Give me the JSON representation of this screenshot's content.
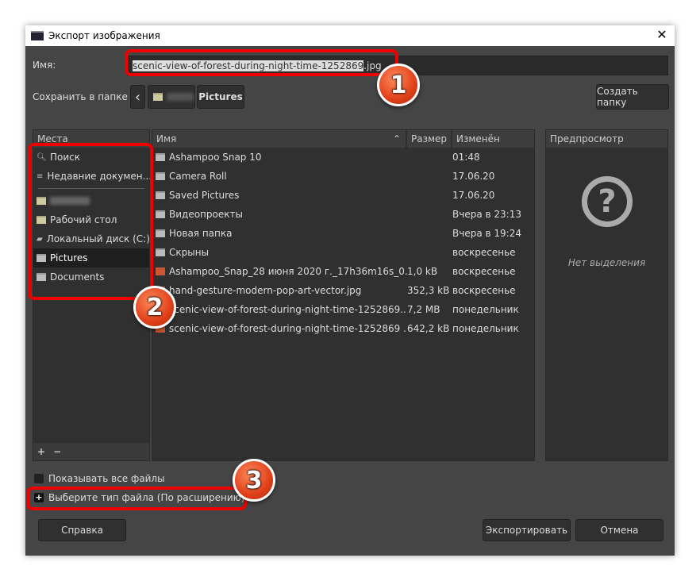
{
  "window": {
    "title": "Экспорт изображения",
    "close": "✕"
  },
  "name": {
    "label": "Имя:",
    "value_selected": "scenic-view-of-forest-during-night-time-1252869",
    "value_ext": ".jpg"
  },
  "folder": {
    "label": "Сохранить в папке",
    "back": "‹",
    "current": "Pictures",
    "create_button": "Создать папку"
  },
  "places": {
    "header": "Места",
    "items": [
      {
        "label": "Поиск",
        "icon": "search-icon"
      },
      {
        "label": "Недавние докумен...",
        "icon": "recent-icon"
      },
      {
        "label": "",
        "icon": "folder-icon"
      },
      {
        "label": "Рабочий стол",
        "icon": "folder-icon"
      },
      {
        "label": "Локальный диск (C:)",
        "icon": "drive-icon"
      },
      {
        "label": "Pictures",
        "icon": "folder-icon",
        "selected": true
      },
      {
        "label": "Documents",
        "icon": "folder-icon"
      }
    ],
    "add": "+",
    "remove": "−"
  },
  "files": {
    "columns": [
      "Имя",
      "Размер",
      "Изменён"
    ],
    "sort_icon": "⌃",
    "rows": [
      {
        "name": "Ashampoo Snap 10",
        "size": "",
        "modified": "01:48",
        "type": "folder"
      },
      {
        "name": "Camera Roll",
        "size": "",
        "modified": "17.06.20",
        "type": "folder"
      },
      {
        "name": "Saved Pictures",
        "size": "",
        "modified": "17.06.20",
        "type": "folder"
      },
      {
        "name": "Видеопроекты",
        "size": "",
        "modified": "Вчера в 23:13",
        "type": "folder"
      },
      {
        "name": "Новая папка",
        "size": "",
        "modified": "Вчера в 19:24",
        "type": "folder"
      },
      {
        "name": "Скрыны",
        "size": "",
        "modified": "воскресенье",
        "type": "folder"
      },
      {
        "name": "Ashampoo_Snap_28 июня 2020 г._17h36m16s_0...",
        "size": "1,0 kB",
        "modified": "воскресенье",
        "type": "image"
      },
      {
        "name": "hand-gesture-modern-pop-art-vector.jpg",
        "size": "352,3 kB",
        "modified": "воскресенье",
        "type": "image"
      },
      {
        "name": "scenic-view-of-forest-during-night-time-1252869....",
        "size": "7,2 MB",
        "modified": "понедельник",
        "type": "image"
      },
      {
        "name": "scenic-view-of-forest-during-night-time-1252869 ...",
        "size": "642,2 kB",
        "modified": "понедельник",
        "type": "image"
      }
    ]
  },
  "preview": {
    "header": "Предпросмотр",
    "icon": "?",
    "empty": "Нет выделения"
  },
  "options": {
    "show_all": "Показывать все файлы",
    "file_type": "Выберите тип файла (По расширению)"
  },
  "buttons": {
    "help": "Справка",
    "export": "Экспортировать",
    "cancel": "Отмена"
  },
  "badges": [
    "1",
    "2",
    "3"
  ],
  "colors": {
    "highlight": "#e00000"
  }
}
